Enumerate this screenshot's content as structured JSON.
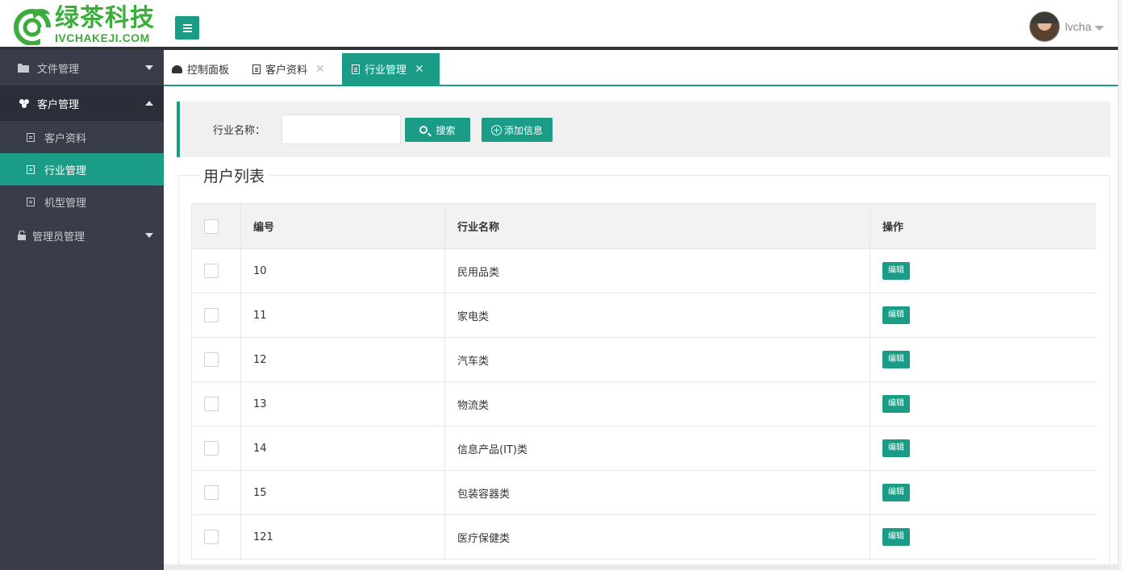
{
  "brand": {
    "name_cn": "绿茶科技",
    "name_en": "IVCHAKEJI.COM",
    "color": "#3cad3c"
  },
  "theme": {
    "accent": "#1a9c86",
    "sidebar_bg": "#393d49"
  },
  "header": {
    "menu_toggle_icon": "hamburger-icon",
    "user_name": "lvcha"
  },
  "sidebar": {
    "items": [
      {
        "label": "文件管理",
        "icon": "folder-icon",
        "expanded": false
      },
      {
        "label": "客户管理",
        "icon": "group-icon",
        "expanded": true,
        "children": [
          {
            "label": "客户资料",
            "active": false
          },
          {
            "label": "行业管理",
            "active": true
          },
          {
            "label": "机型管理",
            "active": false
          }
        ]
      },
      {
        "label": "管理员管理",
        "icon": "lock-icon",
        "expanded": false
      }
    ]
  },
  "tabs": [
    {
      "label": "控制面板",
      "icon": "dashboard-icon",
      "closable": false,
      "active": false
    },
    {
      "label": "客户资料",
      "icon": "document-icon",
      "closable": true,
      "active": false
    },
    {
      "label": "行业管理",
      "icon": "document-icon",
      "closable": true,
      "active": true
    }
  ],
  "search": {
    "label": "行业名称：",
    "value": "",
    "search_button": "搜索",
    "add_button": "添加信息"
  },
  "list": {
    "legend": "用户列表",
    "columns": [
      "编号",
      "行业名称",
      "操作"
    ],
    "edit_label": "编辑",
    "rows": [
      {
        "id": "10",
        "name": "民用品类"
      },
      {
        "id": "11",
        "name": "家电类"
      },
      {
        "id": "12",
        "name": "汽车类"
      },
      {
        "id": "13",
        "name": "物流类"
      },
      {
        "id": "14",
        "name": "信息产品(IT)类"
      },
      {
        "id": "15",
        "name": "包装容器类"
      },
      {
        "id": "121",
        "name": "医疗保健类"
      }
    ]
  }
}
